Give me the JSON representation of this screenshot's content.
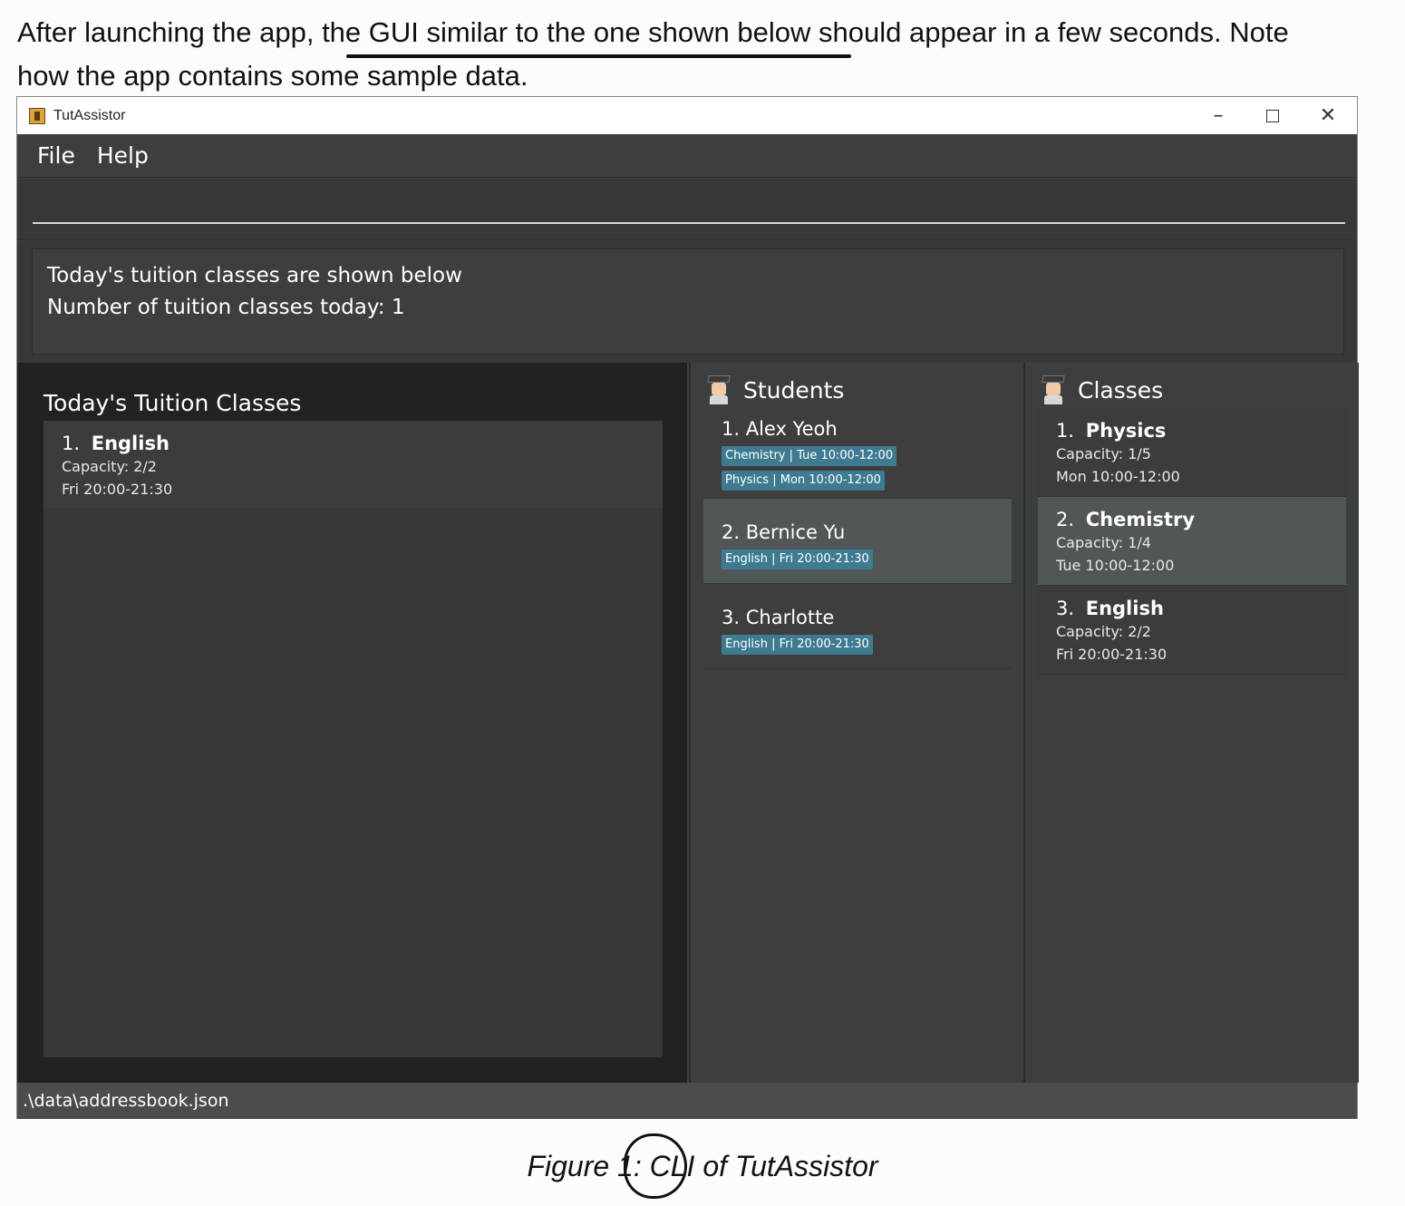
{
  "intro": {
    "line1": "After launching the app, the GUI similar to the one shown below should appear in a few seconds. Note",
    "line2": "how the app contains some sample data."
  },
  "window": {
    "title": "TutAssistor",
    "controls": {
      "minimize": "–",
      "close": "✕"
    }
  },
  "menu": {
    "file": "File",
    "help": "Help"
  },
  "command": {
    "value": "",
    "placeholder": ""
  },
  "result": {
    "line1": "Today's tuition classes are shown below",
    "line2": "Number of tuition classes today: 1"
  },
  "today": {
    "heading": "Today's Tuition Classes",
    "items": [
      {
        "index": "1.",
        "name": "English",
        "capacity": "Capacity: 2/2",
        "time": "Fri 20:00-21:30"
      }
    ]
  },
  "students": {
    "heading": "Students",
    "items": [
      {
        "index": "1.",
        "name": "Alex Yeoh",
        "tags": [
          "Chemistry | Tue 10:00-12:00",
          "Physics | Mon 10:00-12:00"
        ]
      },
      {
        "index": "2.",
        "name": "Bernice Yu",
        "tags": [
          "English | Fri 20:00-21:30"
        ]
      },
      {
        "index": "3.",
        "name": "Charlotte",
        "tags": [
          "English | Fri 20:00-21:30"
        ]
      }
    ]
  },
  "classes": {
    "heading": "Classes",
    "items": [
      {
        "index": "1.",
        "name": "Physics",
        "capacity": "Capacity: 1/5",
        "time": "Mon 10:00-12:00"
      },
      {
        "index": "2.",
        "name": "Chemistry",
        "capacity": "Capacity: 1/4",
        "time": "Tue 10:00-12:00"
      },
      {
        "index": "3.",
        "name": "English",
        "capacity": "Capacity: 2/2",
        "time": "Fri 20:00-21:30"
      }
    ]
  },
  "status": {
    "path": ".\\data\\addressbook.json"
  },
  "caption": {
    "text": "Figure 1: CLI of TutAssistor"
  },
  "colors": {
    "window_bg": "#3c3f41",
    "today_panel_bg": "#222222",
    "tag_bg": "#3e7b91",
    "selected_row": "#515658"
  }
}
